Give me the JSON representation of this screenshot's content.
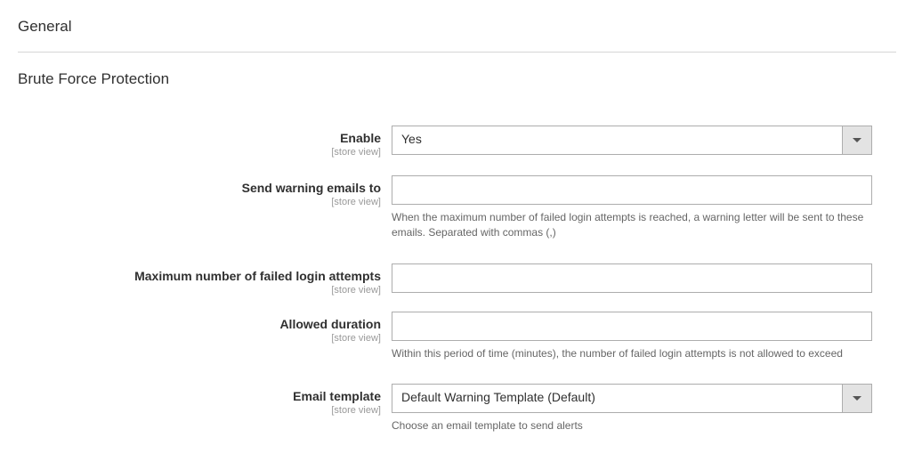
{
  "sections": {
    "general": {
      "title": "General"
    },
    "brute": {
      "title": "Brute Force Protection"
    }
  },
  "scope_label": "[store view]",
  "fields": {
    "enable": {
      "label": "Enable",
      "value": "Yes"
    },
    "warning_emails": {
      "label": "Send warning emails to",
      "value": "",
      "help": "When the maximum number of failed login attempts is reached, a warning letter will be sent to these emails. Separated with commas (,)"
    },
    "max_failed": {
      "label": "Maximum number of failed login attempts",
      "value": ""
    },
    "allowed_duration": {
      "label": "Allowed duration",
      "value": "",
      "help": "Within this period of time (minutes), the number of failed login attempts is not allowed to exceed"
    },
    "email_template": {
      "label": "Email template",
      "value": "Default Warning Template (Default)",
      "help": "Choose an email template to send alerts"
    }
  }
}
